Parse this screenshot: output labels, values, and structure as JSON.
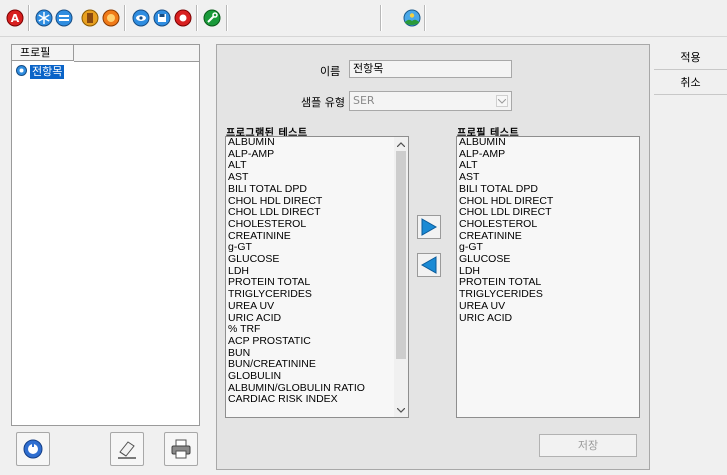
{
  "toolbar": {
    "icons": [
      "alert-icon",
      "snowflake-icon",
      "database-icon",
      "exit-icon",
      "settings-wheel-icon",
      "eye-icon",
      "disk-icon",
      "record-icon",
      "tool-icon",
      "landscape-icon"
    ]
  },
  "tree": {
    "header": "프로필",
    "items": [
      {
        "label": "전항목"
      }
    ]
  },
  "form": {
    "name_label": "이름",
    "name_value": "전항목",
    "sample_type_label": "샘플 유형",
    "sample_type_value": "SER"
  },
  "programmed_tests": {
    "title": "프로그램된 테스트",
    "items": [
      "ALBUMIN",
      "ALP-AMP",
      "ALT",
      "AST",
      "BILI TOTAL DPD",
      "CHOL HDL DIRECT",
      "CHOL LDL DIRECT",
      "CHOLESTEROL",
      "CREATININE",
      "g-GT",
      "GLUCOSE",
      "LDH",
      "PROTEIN TOTAL",
      "TRIGLYCERIDES",
      "UREA UV",
      "URIC ACID",
      "% TRF",
      "ACP PROSTATIC",
      "BUN",
      "BUN/CREATININE",
      "GLOBULIN",
      "ALBUMIN/GLOBULIN RATIO",
      "CARDIAC RISK INDEX"
    ]
  },
  "profile_tests": {
    "title": "프로필 테스트",
    "items": [
      "ALBUMIN",
      "ALP-AMP",
      "ALT",
      "AST",
      "BILI TOTAL DPD",
      "CHOL HDL DIRECT",
      "CHOL LDL DIRECT",
      "CHOLESTEROL",
      "CREATININE",
      "g-GT",
      "GLUCOSE",
      "LDH",
      "PROTEIN TOTAL",
      "TRIGLYCERIDES",
      "UREA UV",
      "URIC ACID"
    ]
  },
  "buttons": {
    "save": "저장",
    "apply": "적용",
    "cancel": "취소"
  },
  "colors": {
    "selection": "#0a64c8",
    "arrow_blue": "#1a8ad4"
  }
}
